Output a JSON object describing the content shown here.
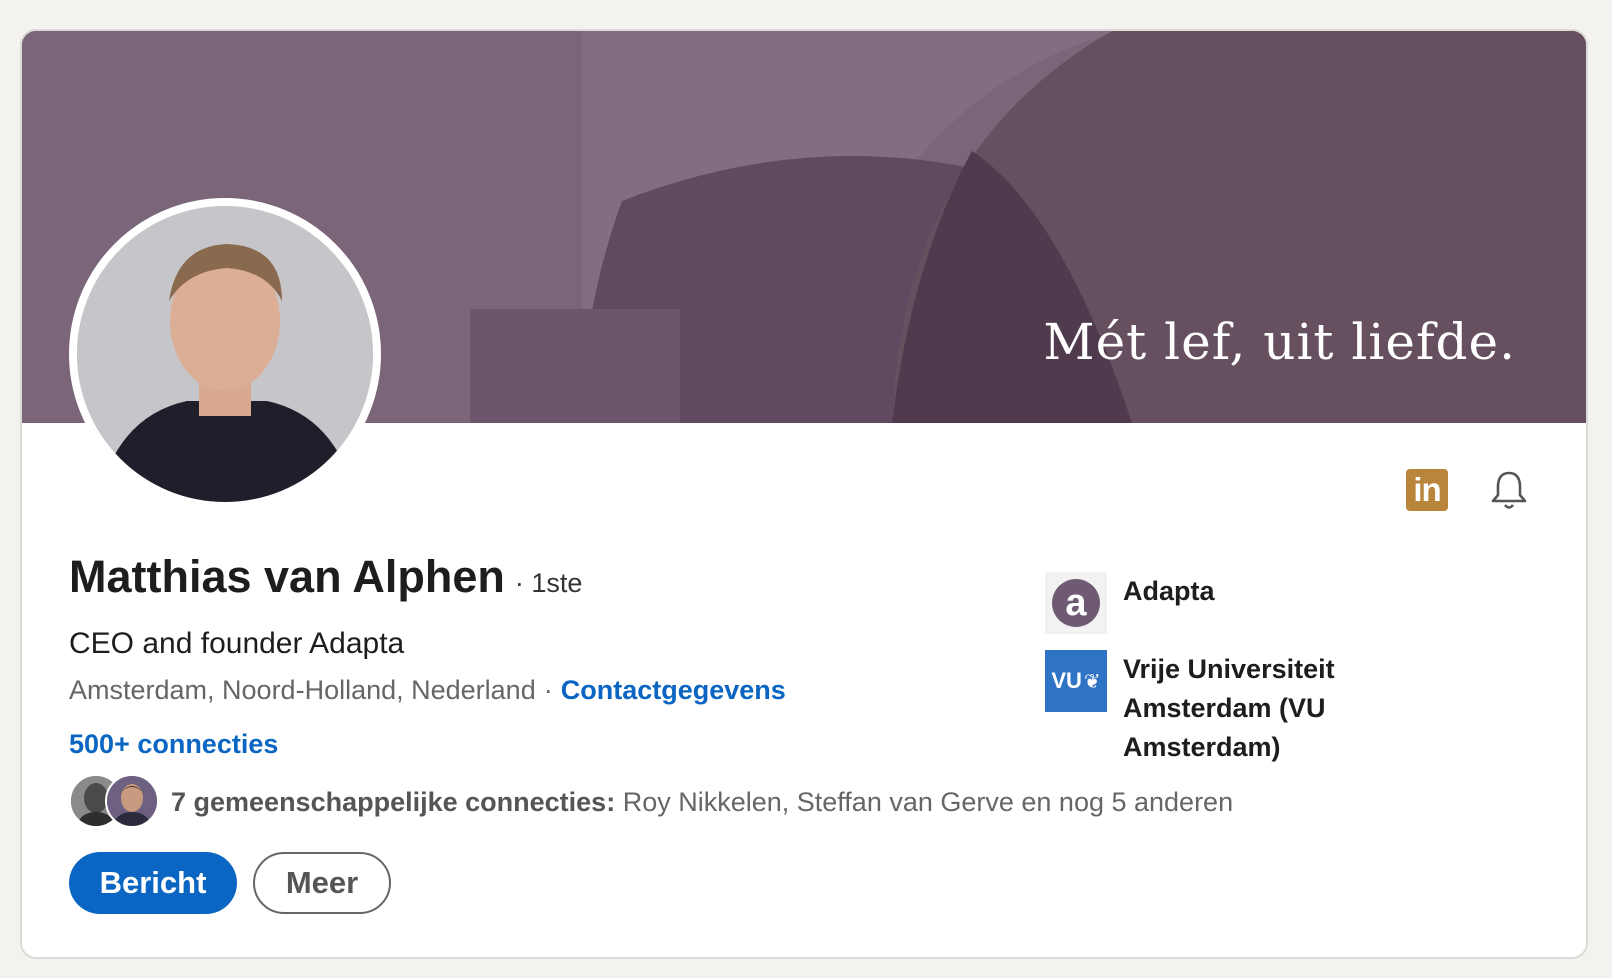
{
  "banner": {
    "tagline": "Mét lef, uit liefde.",
    "color": "#7a6579"
  },
  "profile": {
    "name": "Matthias van Alphen",
    "degree": "· 1ste",
    "headline": "CEO and founder Adapta",
    "location": "Amsterdam, Noord-Holland, Nederland",
    "separator": "·",
    "contact_link": "Contactgegevens",
    "connections": "500+ connecties"
  },
  "mutual": {
    "count_label": "7 gemeenschappelijke connecties:",
    "names": "Roy Nikkelen, Steffan van Gerve en nog 5 anderen"
  },
  "actions": {
    "primary": "Bericht",
    "secondary": "Meer"
  },
  "top_icons": {
    "linkedin": "in",
    "bell": "bell-icon"
  },
  "organizations": [
    {
      "name": "Adapta",
      "logo": "a"
    },
    {
      "name": "Vrije Universiteit Amsterdam (VU Amsterdam)",
      "logo": "VU"
    }
  ],
  "colors": {
    "link": "#0a66c2",
    "premium_badge": "#b9853a"
  }
}
